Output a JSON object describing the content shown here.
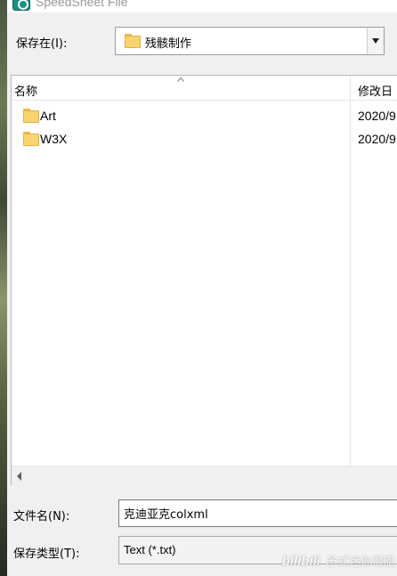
{
  "window": {
    "title": "SpeedSheet File"
  },
  "save_in": {
    "label": "保存在(I):",
    "value": "残骸制作"
  },
  "file_list": {
    "columns": [
      "名称",
      "修改日"
    ],
    "rows": [
      {
        "name": "Art",
        "date": "2020/9",
        "icon": "folder-icon"
      },
      {
        "name": "W3X",
        "date": "2020/9",
        "icon": "folder-icon"
      }
    ]
  },
  "file_name": {
    "label": "文件名(N):",
    "value": "克迪亚克colxml"
  },
  "file_type": {
    "label": "保存类型(T):",
    "value": "Text (*.txt)"
  },
  "watermark": {
    "logo": "bilibili",
    "text": "矛式迷你潜艇"
  },
  "colors": {
    "folder": "#f7d46d",
    "app_icon": "#1e8f86",
    "background": "#f0f0f0"
  }
}
